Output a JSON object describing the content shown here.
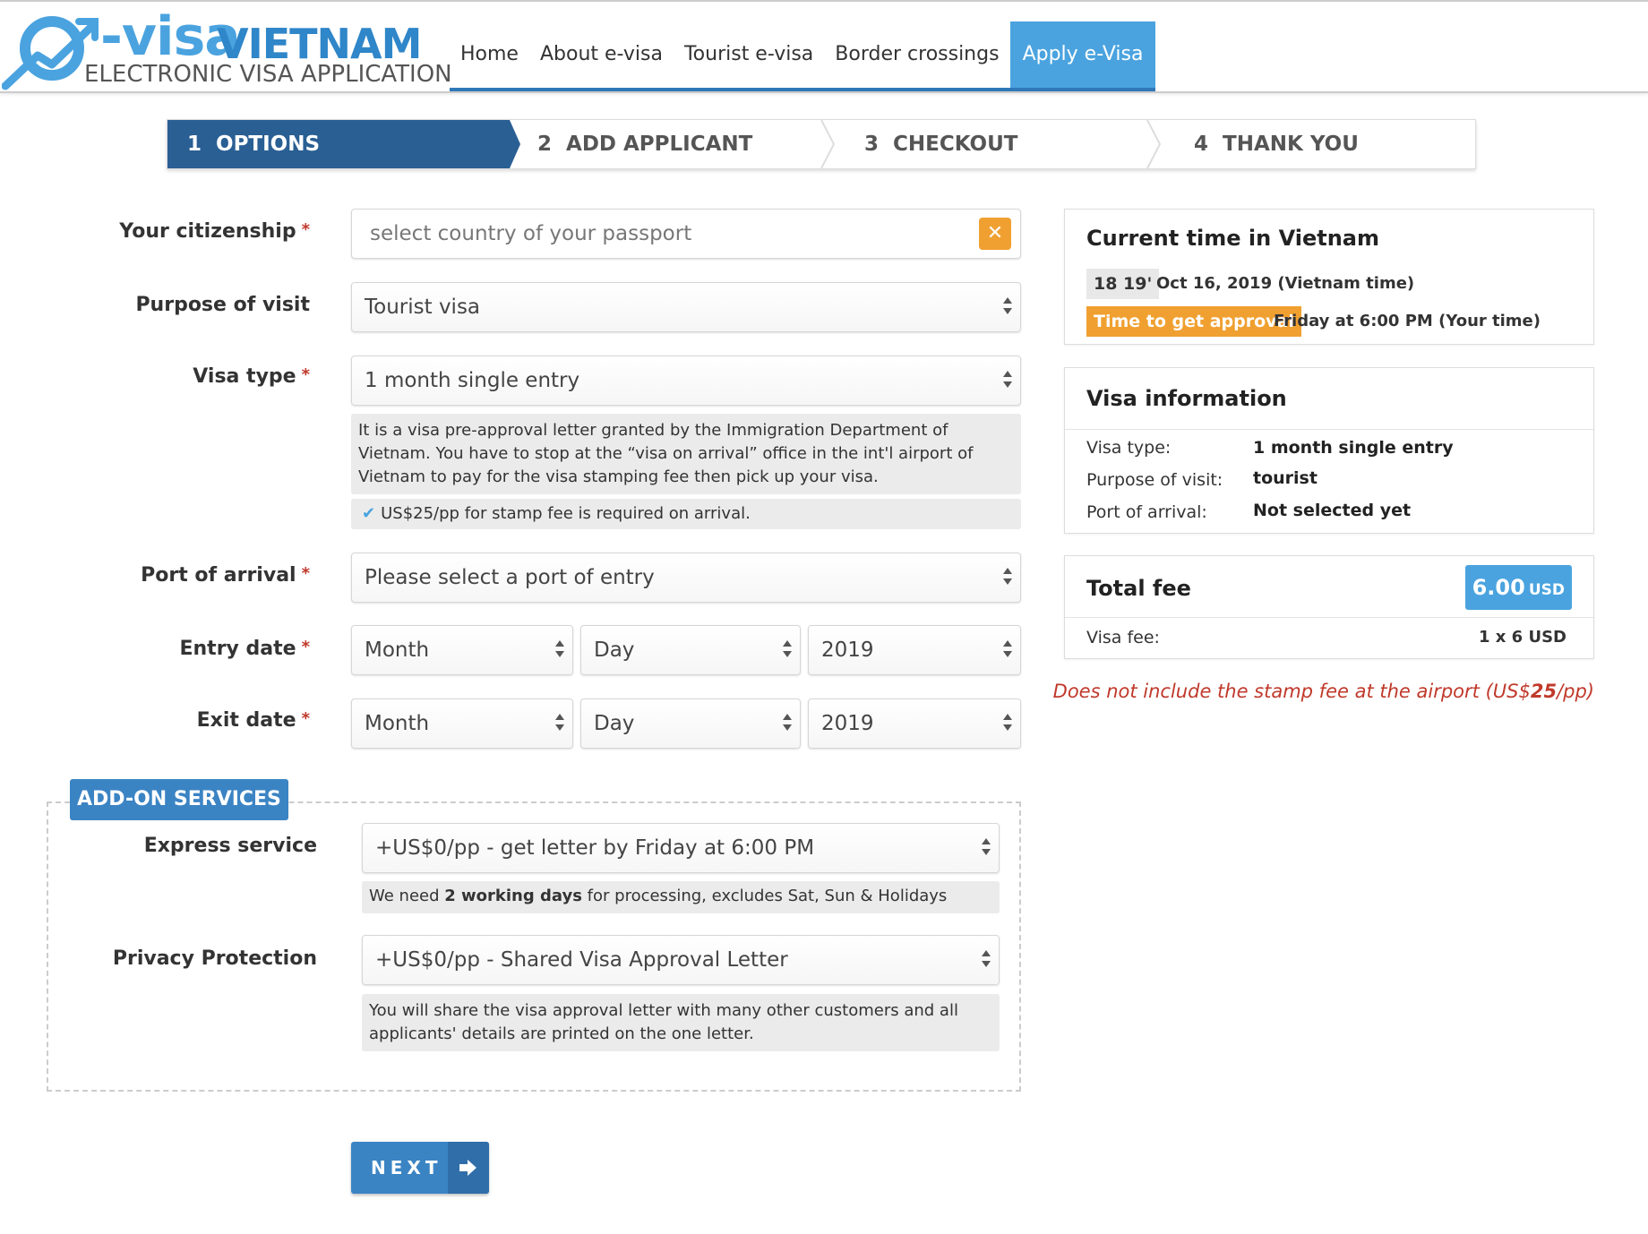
{
  "brand": {
    "logo_visa": "-visa",
    "logo_vietnam": "VIETNAM",
    "logo_sub": "ELECTRONIC VISA APPLICATION"
  },
  "nav": {
    "items": [
      {
        "label": "Home"
      },
      {
        "label": "About e-visa"
      },
      {
        "label": "Tourist e-visa"
      },
      {
        "label": "Border crossings"
      },
      {
        "label": "Apply e-Visa",
        "active": true
      }
    ]
  },
  "steps": [
    {
      "num": "1",
      "label": "OPTIONS",
      "active": true
    },
    {
      "num": "2",
      "label": "ADD APPLICANT"
    },
    {
      "num": "3",
      "label": "CHECKOUT"
    },
    {
      "num": "4",
      "label": "THANK YOU"
    }
  ],
  "form": {
    "citizenship": {
      "label": "Your citizenship",
      "required": "*",
      "placeholder": "select country of your passport"
    },
    "purpose": {
      "label": "Purpose of visit",
      "value": "Tourist visa"
    },
    "visa_type": {
      "label": "Visa type",
      "required": "*",
      "value": "1 month single entry",
      "note": "It is a visa pre-approval letter granted by the Immigration Department of Vietnam. You have to stop at the “visa on arrival” office in the int'l airport of Vietnam to pay for the visa stamping fee then pick up your visa.",
      "stamp_note": "US$25/pp for stamp fee is required on arrival."
    },
    "port": {
      "label": "Port of arrival",
      "required": "*",
      "value": "Please select a port of entry"
    },
    "entry_date": {
      "label": "Entry date",
      "required": "*",
      "month": "Month",
      "day": "Day",
      "year": "2019"
    },
    "exit_date": {
      "label": "Exit date",
      "required": "*",
      "month": "Month",
      "day": "Day",
      "year": "2019"
    }
  },
  "addon": {
    "title": "ADD-ON SERVICES",
    "express": {
      "label": "Express service",
      "value": "+US$0/pp - get letter by Friday at 6:00 PM",
      "note_pre": "We need ",
      "note_bold": "2 working days",
      "note_post": " for processing, excludes Sat, Sun & Holidays"
    },
    "privacy": {
      "label": "Privacy Protection",
      "value": "+US$0/pp - Shared Visa Approval Letter",
      "note": "You will share the visa approval letter with many other customers and all applicants' details are printed on the one letter."
    }
  },
  "next_button": {
    "label": "NEXT"
  },
  "sidebar": {
    "time": {
      "title": "Current time in Vietnam",
      "clock": "18 19'",
      "date": "Oct 16, 2019 (Vietnam time)",
      "approval_label": "Time to get approval",
      "approval_value": "Friday at 6:00 PM (Your time)"
    },
    "visa_info": {
      "title": "Visa information",
      "rows": [
        {
          "key": "Visa type:",
          "value": "1 month single entry"
        },
        {
          "key": "Purpose of visit:",
          "value": "tourist"
        },
        {
          "key": "Port of arrival:",
          "value": "Not selected yet"
        }
      ]
    },
    "fee": {
      "title": "Total fee",
      "amount": "6.00",
      "currency": "USD",
      "row_key": "Visa fee:",
      "row_value": "1 x 6 USD"
    },
    "disclaimer_pre": "Does not include the stamp fee at the airport (US$",
    "disclaimer_bold": "25",
    "disclaimer_post": "/pp)"
  },
  "colors": {
    "accent": "#4aa3df",
    "dark_blue": "#2a5f94",
    "orange": "#f0a030",
    "required_red": "#c0392b"
  },
  "icons": [
    "logo-swoosh-icon",
    "clear-icon",
    "select-arrows-icon",
    "checkmark-icon",
    "arrow-right-icon"
  ]
}
